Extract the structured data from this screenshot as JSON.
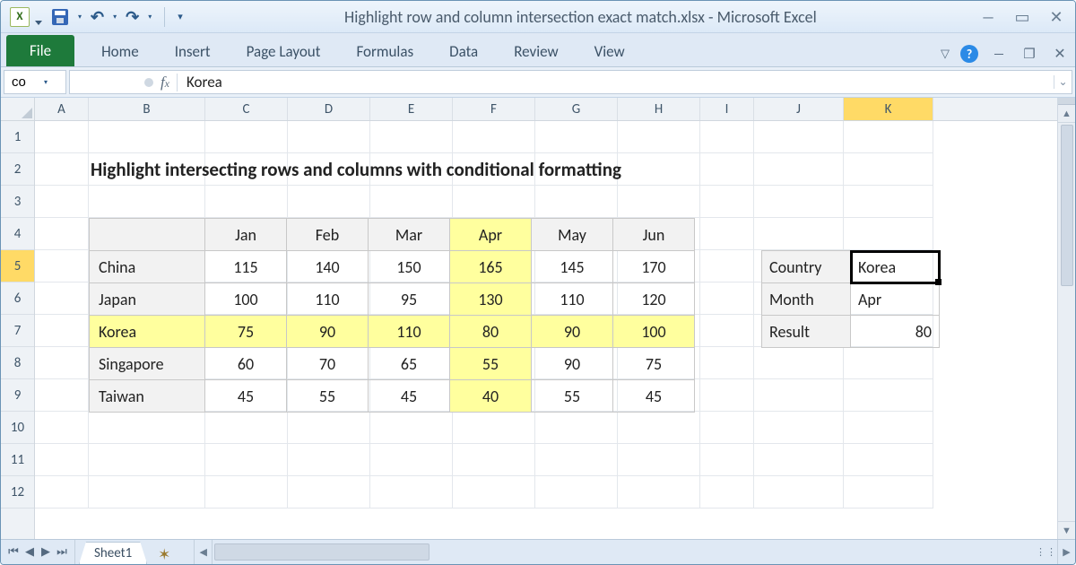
{
  "window": {
    "title": "Highlight row and column intersection exact match.xlsx  -  Microsoft Excel"
  },
  "ribbon": {
    "file": "File",
    "tabs": [
      "Home",
      "Insert",
      "Page Layout",
      "Formulas",
      "Data",
      "Review",
      "View"
    ]
  },
  "namebox": "co",
  "formula": "Korea",
  "columns": [
    "A",
    "B",
    "C",
    "D",
    "E",
    "F",
    "G",
    "H",
    "I",
    "J",
    "K"
  ],
  "rows": [
    "1",
    "2",
    "3",
    "4",
    "5",
    "6",
    "7",
    "8",
    "9",
    "10",
    "11",
    "12"
  ],
  "selected_col": "K",
  "selected_row": "5",
  "heading": "Highlight intersecting rows and columns with conditional formatting",
  "table": {
    "months": [
      "Jan",
      "Feb",
      "Mar",
      "Apr",
      "May",
      "Jun"
    ],
    "countries": [
      "China",
      "Japan",
      "Korea",
      "Singapore",
      "Taiwan"
    ],
    "values": [
      [
        115,
        140,
        150,
        165,
        145,
        170
      ],
      [
        100,
        110,
        95,
        130,
        110,
        120
      ],
      [
        75,
        90,
        110,
        80,
        90,
        100
      ],
      [
        60,
        70,
        65,
        55,
        90,
        75
      ],
      [
        45,
        55,
        45,
        40,
        55,
        45
      ]
    ],
    "hl_row": 2,
    "hl_col": 3
  },
  "lookup": {
    "labels": [
      "Country",
      "Month",
      "Result"
    ],
    "values": [
      "Korea",
      "Apr",
      "80"
    ]
  },
  "sheet_tab": "Sheet1",
  "chart_data": {
    "type": "table",
    "title": "Highlight intersecting rows and columns with conditional formatting",
    "columns": [
      "Jan",
      "Feb",
      "Mar",
      "Apr",
      "May",
      "Jun"
    ],
    "rows": [
      "China",
      "Japan",
      "Korea",
      "Singapore",
      "Taiwan"
    ],
    "values": [
      [
        115,
        140,
        150,
        165,
        145,
        170
      ],
      [
        100,
        110,
        95,
        130,
        110,
        120
      ],
      [
        75,
        90,
        110,
        80,
        90,
        100
      ],
      [
        60,
        70,
        65,
        55,
        90,
        75
      ],
      [
        45,
        55,
        45,
        40,
        55,
        45
      ]
    ]
  }
}
